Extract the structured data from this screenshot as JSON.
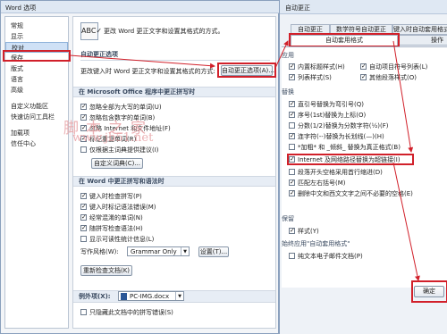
{
  "word_options": {
    "title": "Word 选项",
    "sidebar": [
      "常规",
      "显示",
      "校对",
      "保存",
      "版式",
      "语言",
      "高级",
      "自定义功能区",
      "快速访问工具栏",
      "加载项",
      "信任中心"
    ],
    "intro": "更改 Word 更正文字和设置其格式的方式。",
    "autocorrect_section": "自动更正选项",
    "autocorrect_desc": "更改键入时 Word 更正文字和设置其格式的方式:",
    "autocorrect_button": "自动更正选项(A)...",
    "office_section": "在 Microsoft Office 程序中更正拼写时",
    "office_options": [
      {
        "label": "忽略全部为大写的单词(U)",
        "checked": true
      },
      {
        "label": "忽略包含数字的单词(B)",
        "checked": true
      },
      {
        "label": "忽略 Internet 和文件地址(F)",
        "checked": true
      },
      {
        "label": "标记重复单词(R)",
        "checked": true
      },
      {
        "label": "仅根据主词典提供建议(I)",
        "checked": false
      }
    ],
    "custom_dict_button": "自定义词典(C)...",
    "word_section": "在 Word 中更正拼写和语法时",
    "word_options": [
      {
        "label": "键入时检查拼写(P)",
        "checked": true
      },
      {
        "label": "键入时标记语法错误(M)",
        "checked": true
      },
      {
        "label": "经常混淆的单词(N)",
        "checked": true
      },
      {
        "label": "随拼写检查语法(H)",
        "checked": true
      },
      {
        "label": "显示可读性统计信息(L)",
        "checked": false
      }
    ],
    "writing_style_label": "写作风格(W):",
    "writing_style_value": "Grammar Only",
    "settings_button": "设置(T)...",
    "recheck_button": "重新检查文档(K)",
    "exception_label": "例外项(X):",
    "exception_file": "PC-IMG.docx",
    "exception_option": {
      "label": "只隐藏此文档中的拼写错误(S)",
      "checked": false
    }
  },
  "watermark": {
    "line1": "脚本之家",
    "line2": "www.jb51.net"
  },
  "autocorrect_dialog": {
    "title": "自动更正",
    "tabs_row1": [
      "自动更正",
      "数学符号自动更正",
      "键入时自动套用格式"
    ],
    "tabs_row2": [
      "自动套用格式",
      "操作"
    ],
    "apply_section": "应用",
    "apply_options": [
      {
        "label": "内置标题样式(H)",
        "checked": true
      },
      {
        "label": "自动项目符号列表(L)",
        "checked": true
      },
      {
        "label": "列表样式(S)",
        "checked": true
      },
      {
        "label": "其他段落样式(O)",
        "checked": true
      }
    ],
    "replace_section": "替换",
    "replace_options": [
      {
        "label": "直引号替换为弯引号(Q)",
        "checked": true
      },
      {
        "label": "序号(1st)替换为上标(O)",
        "checked": true
      },
      {
        "label": "分数(1/2)替换为分数字符(½)(F)",
        "checked": false
      },
      {
        "label": "连字符(--)替换为长划线(—)(H)",
        "checked": true
      },
      {
        "label": "*加粗* 和 _倾斜_ 替换为真正格式(B)",
        "checked": false
      },
      {
        "label": "Internet 及网络路径替换为超链接(I)",
        "checked": true
      },
      {
        "label": "段落开头空格采用首行缩进(D)",
        "checked": false
      },
      {
        "label": "匹配左右括号(M)",
        "checked": true
      },
      {
        "label": "删除中文和西文文字之间不必要的空格(E)",
        "checked": true
      }
    ],
    "keep_section": "保留",
    "keep_options": [
      {
        "label": "样式(Y)",
        "checked": true
      }
    ],
    "always_section": "始终应用\"自动套用格式\"",
    "always_options": [
      {
        "label": "纯文本电子邮件文档(P)",
        "checked": false
      }
    ],
    "ok_button": "确定"
  }
}
